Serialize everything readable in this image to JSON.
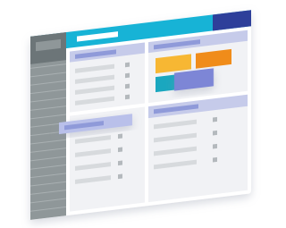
{
  "illustration": {
    "description_free": true,
    "colors": {
      "background": "#ffffff",
      "window_frame": "#ffffff",
      "topbar_cyan": "#17b3d6",
      "topbar_navy": "#2e3f9a",
      "sidebar": "#8f9799",
      "sidebar_header": "#6c7578",
      "sidebar_line": "#a9b0b2",
      "panel_bg": "#f1f2f5",
      "panel_header": "#c6cbea",
      "panel_header_bar": "#8f9ad9",
      "row_bar": "#d7dadd",
      "row_square": "#b4b9bd",
      "orange_light": "#f7b733",
      "orange_dark": "#f08c1a",
      "teal": "#1aa7bf",
      "indigo": "#7d86d6",
      "floating_row": "#b9c0ea"
    },
    "panels": [
      {
        "name": "top-left",
        "rows": 4
      },
      {
        "name": "top-right",
        "tiles": 4
      },
      {
        "name": "bottom-left",
        "rows": 4
      },
      {
        "name": "bottom-right",
        "rows": 4
      }
    ],
    "sidebar_rows": 18
  }
}
